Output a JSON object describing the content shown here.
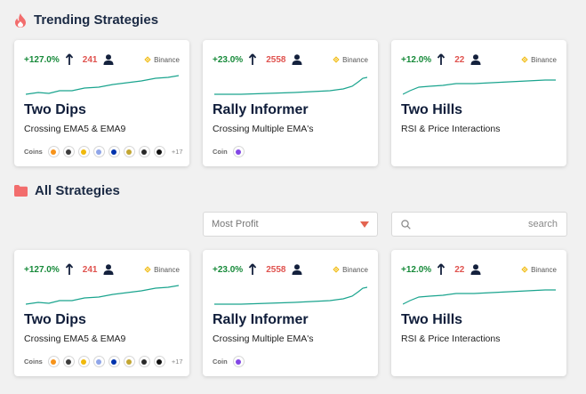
{
  "sections": {
    "trending_title": "Trending Strategies",
    "all_title": "All Strategies"
  },
  "filters": {
    "sort_value": "Most Profit",
    "search_placeholder": "search"
  },
  "colors": {
    "gain": "#178a3a",
    "count": "#e0534f",
    "sparkline": "#1aa48e",
    "accent": "#e46450"
  },
  "icons": [
    "fire-icon",
    "folder-icon",
    "arrow-up-icon",
    "user-icon",
    "binance-icon",
    "search-icon",
    "caret-down-icon"
  ],
  "trending": [
    {
      "gain": "+127.0%",
      "count": "241",
      "exchange": "Binance",
      "name": "Two Dips",
      "desc": "Crossing EMA5 & EMA9",
      "coins_label": "Coins",
      "coins_more": "+17"
    },
    {
      "gain": "+23.0%",
      "count": "2558",
      "exchange": "Binance",
      "name": "Rally Informer",
      "desc": "Crossing Multiple EMA's",
      "coins_label": "Coin"
    },
    {
      "gain": "+12.0%",
      "count": "22",
      "exchange": "Binance",
      "name": "Two Hills",
      "desc": "RSI & Price Interactions"
    }
  ],
  "all": [
    {
      "gain": "+127.0%",
      "count": "241",
      "exchange": "Binance",
      "name": "Two Dips",
      "desc": "Crossing EMA5 & EMA9",
      "coins_label": "Coins",
      "coins_more": "+17"
    },
    {
      "gain": "+23.0%",
      "count": "2558",
      "exchange": "Binance",
      "name": "Rally Informer",
      "desc": "Crossing Multiple EMA's",
      "coins_label": "Coin"
    },
    {
      "gain": "+12.0%",
      "count": "22",
      "exchange": "Binance",
      "name": "Two Hills",
      "desc": "RSI & Price Interactions"
    }
  ]
}
